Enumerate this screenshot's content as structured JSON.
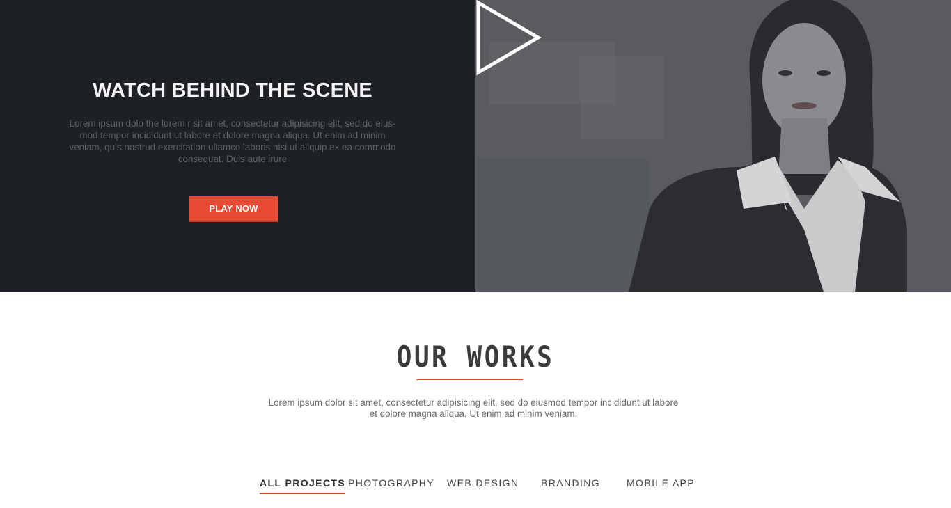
{
  "video": {
    "title": "WATCH BEHIND THE SCENE",
    "description": "Lorem ipsum dolo the lorem r sit amet, consectetur adipisicing elit, sed do eius-mod tempor incididunt ut labore et dolore magna aliqua. Ut enim ad minim veniam, quis nostrud exercitation ullamco laboris nisi ut aliquip ex ea commodo consequat. Duis aute irure",
    "play_button": "PLAY NOW",
    "play_icon": "play-icon"
  },
  "works": {
    "title": "OUR WORKS",
    "description": "Lorem ipsum dolor sit amet, consectetur adipisicing elit, sed do eiusmod tempor incididunt ut labore et dolore magna aliqua. Ut enim ad minim veniam.",
    "filters": [
      "ALL PROJECTS",
      "PHOTOGRAPHY",
      "WEB DESIGN",
      "BRANDING",
      "MOBILE APP"
    ],
    "active_filter": "ALL PROJECTS"
  },
  "colors": {
    "accent": "#e64a35",
    "dark_panel": "#1d2025",
    "photo_overlay": "#56585d",
    "heading": "#3b3b3d"
  }
}
